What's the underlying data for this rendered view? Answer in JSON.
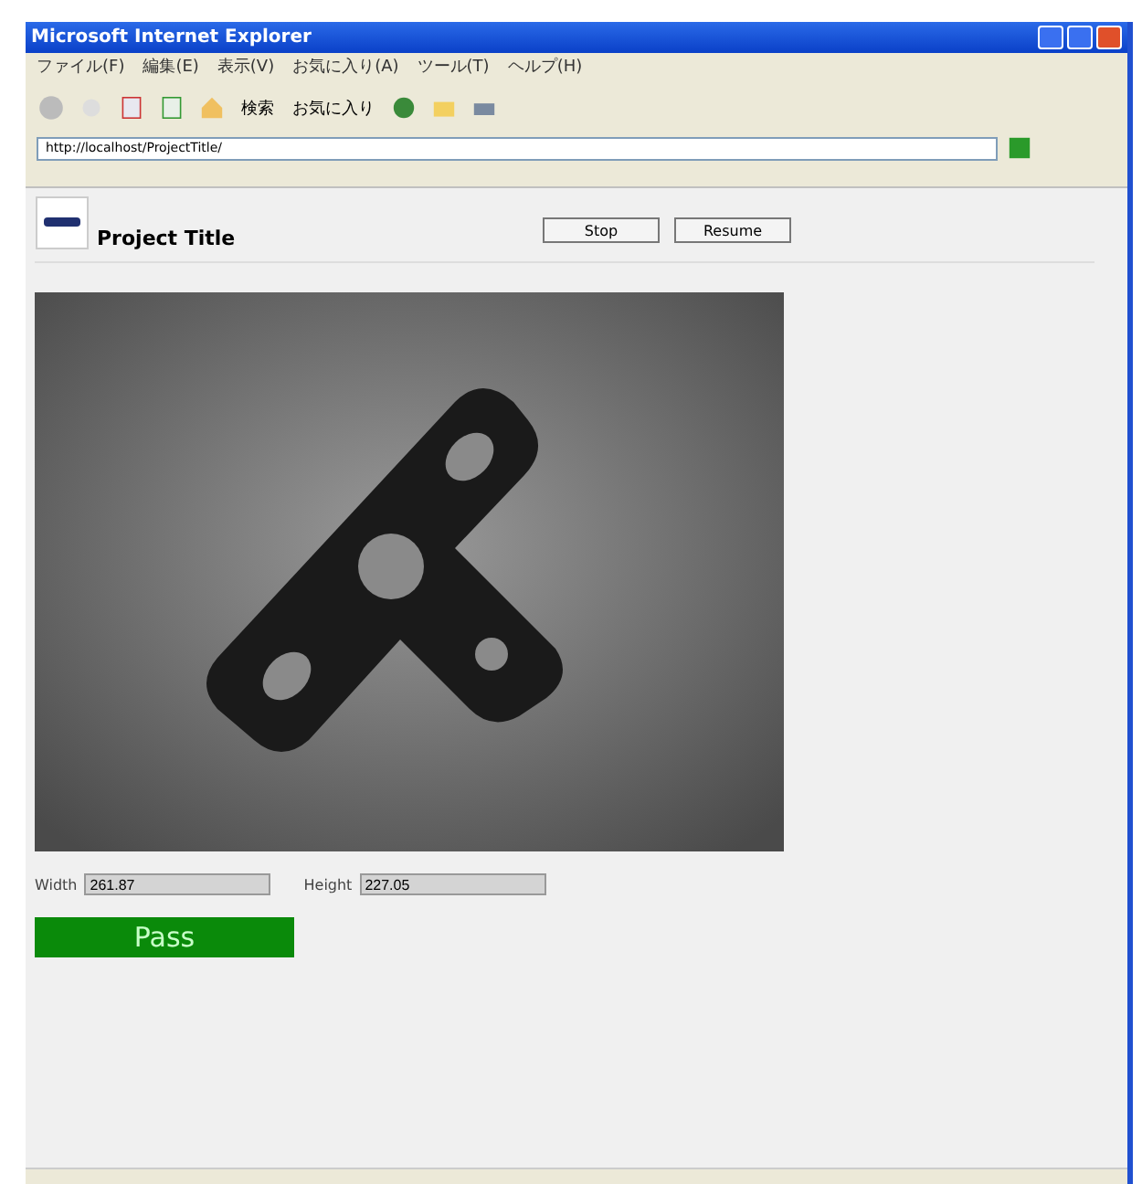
{
  "window": {
    "title": "Microsoft Internet Explorer"
  },
  "menu": [
    "ファイル(F)",
    "編集(E)",
    "表示(V)",
    "お気に入り(A)",
    "ツール(T)",
    "ヘルプ(H)"
  ],
  "toolbar": {
    "search_label": "検索",
    "favorites_label": "お気に入り"
  },
  "address": {
    "value": "http://localhost/ProjectTitle/"
  },
  "page": {
    "title": "Project Title",
    "buttons": [
      "Stop",
      "Resume"
    ],
    "fields": [
      {
        "label": "Width",
        "value": "261.87"
      },
      {
        "label": "Height",
        "value": "227.05"
      }
    ],
    "result": {
      "text": "Pass",
      "kind": "pass"
    }
  }
}
